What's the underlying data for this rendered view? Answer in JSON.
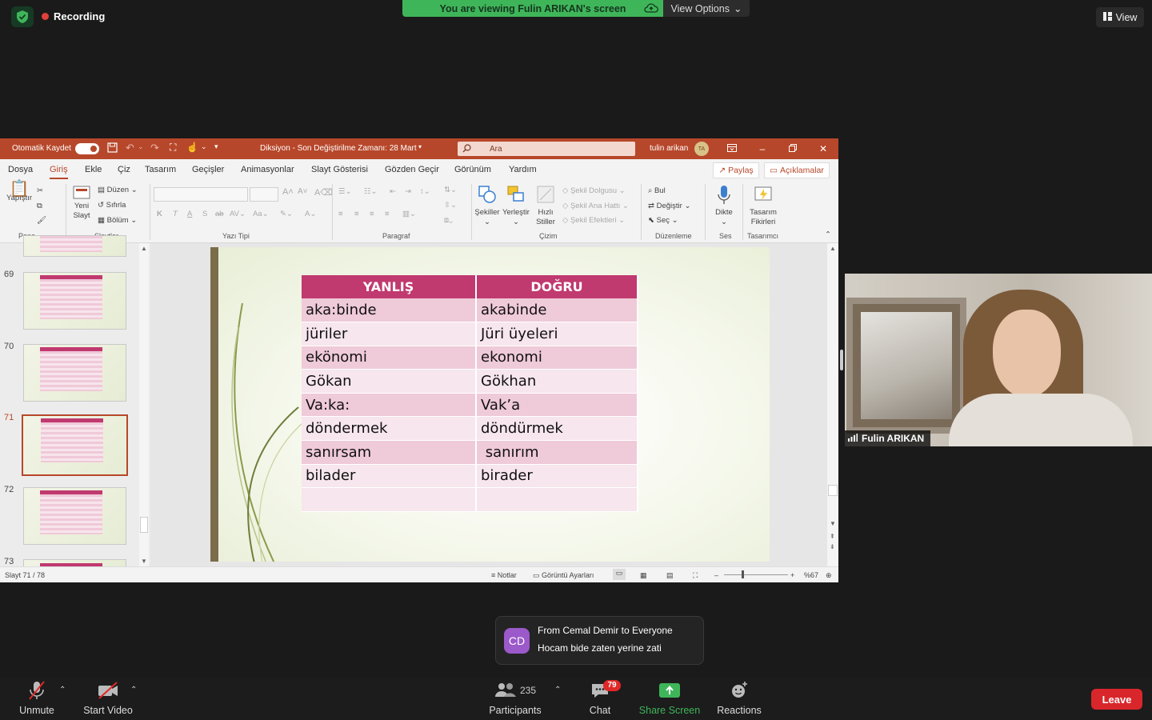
{
  "zoom": {
    "recording_label": "Recording",
    "viewing_banner": "You are viewing Fulin ARIKAN's screen",
    "view_options_label": "View Options",
    "view_button_label": "View",
    "accent_green": "#3fb55a",
    "leave_color": "#d9262b"
  },
  "ppt": {
    "autosave_label": "Otomatik Kaydet",
    "doc_title": "Diksiyon  -  Son Değiştirilme Zamanı: 28 Mart",
    "search_placeholder": "Ara",
    "user_name": "tulin arikan",
    "user_initials": "TA",
    "accent": "#b7472a",
    "menu": [
      "Dosya",
      "Giriş",
      "Ekle",
      "Çiz",
      "Tasarım",
      "Geçişler",
      "Animasyonlar",
      "Slayt Gösterisi",
      "Gözden Geçir",
      "Görünüm",
      "Yardım"
    ],
    "share_label": "Paylaş",
    "comments_label": "Açıklamalar",
    "ribbon": {
      "paste": "Yapıştır",
      "new_slide": "Yeni Slayt",
      "layout": "Düzen",
      "reset": "Sıfırla",
      "section": "Bölüm",
      "shapes": "Şekiller",
      "arrange": "Yerleştir",
      "quick_styles": "Hızlı Stiller",
      "shape_fill": "Şekil Dolgusu",
      "shape_outline": "Şekil Ana Hattı",
      "shape_effects": "Şekil Efektleri",
      "find": "Bul",
      "replace": "Değiştir",
      "select": "Seç",
      "dictate": "Dikte",
      "design_ideas": "Tasarım Fikirleri",
      "groups": {
        "clipboard": "Pano",
        "slides": "Slaytlar",
        "font": "Yazı Tipi",
        "paragraph": "Paragraf",
        "drawing": "Çizim",
        "editing": "Düzenleme",
        "voice": "Ses",
        "designer": "Tasarımcı"
      }
    },
    "thumbnails": [
      {
        "num": "69"
      },
      {
        "num": "70"
      },
      {
        "num": "71",
        "selected": true
      },
      {
        "num": "72"
      },
      {
        "num": "73"
      }
    ],
    "slide_table": {
      "headers": [
        "YANLIŞ",
        "DOĞRU"
      ],
      "rows": [
        [
          "aka:binde",
          "akabinde"
        ],
        [
          "jüriler",
          "Jüri üyeleri"
        ],
        [
          "ekönomi",
          "ekonomi"
        ],
        [
          "Gökan",
          "Gökhan"
        ],
        [
          "Va:ka:",
          "Vak’a"
        ],
        [
          "döndermek",
          "döndürmek"
        ],
        [
          "sanırsam",
          " sanırım"
        ],
        [
          "bilader",
          "birader"
        ],
        [
          "",
          ""
        ]
      ],
      "header_color": "#c0396f"
    },
    "status": {
      "slide_counter": "Slayt 71 / 78",
      "notes_label": "Notlar",
      "display_settings_label": "Görüntü Ayarları",
      "zoom_level": "%67"
    }
  },
  "video": {
    "participant_name": "Fulin ARIKAN"
  },
  "chat_toast": {
    "avatar_initials": "CD",
    "from_line": "From Cemal Demir to Everyone",
    "message": "Hocam bide zaten yerine zati"
  },
  "toolbar": {
    "unmute": "Unmute",
    "start_video": "Start Video",
    "participants_count": "235",
    "participants": "Participants",
    "chat_badge": "79",
    "chat": "Chat",
    "share_screen": "Share Screen",
    "reactions": "Reactions",
    "leave": "Leave"
  }
}
